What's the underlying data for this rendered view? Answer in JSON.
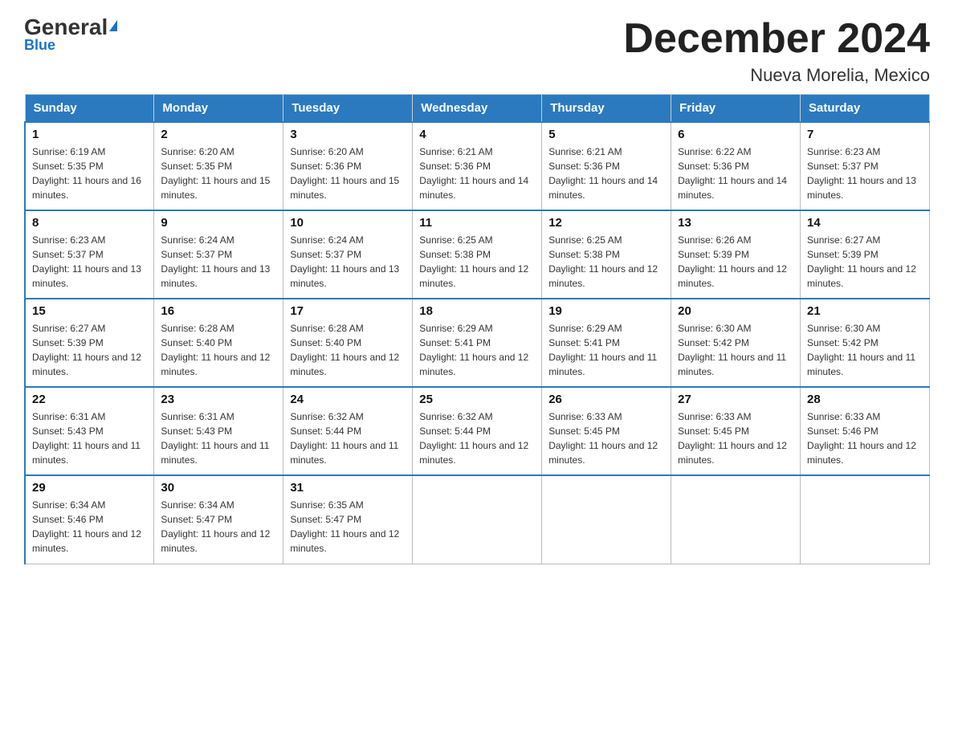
{
  "logo": {
    "main": "General",
    "sub": "Blue",
    "tagline": "Blue"
  },
  "title": "December 2024",
  "subtitle": "Nueva Morelia, Mexico",
  "days_of_week": [
    "Sunday",
    "Monday",
    "Tuesday",
    "Wednesday",
    "Thursday",
    "Friday",
    "Saturday"
  ],
  "weeks": [
    [
      {
        "day": 1,
        "sunrise": "6:19 AM",
        "sunset": "5:35 PM",
        "daylight": "11 hours and 16 minutes."
      },
      {
        "day": 2,
        "sunrise": "6:20 AM",
        "sunset": "5:35 PM",
        "daylight": "11 hours and 15 minutes."
      },
      {
        "day": 3,
        "sunrise": "6:20 AM",
        "sunset": "5:36 PM",
        "daylight": "11 hours and 15 minutes."
      },
      {
        "day": 4,
        "sunrise": "6:21 AM",
        "sunset": "5:36 PM",
        "daylight": "11 hours and 14 minutes."
      },
      {
        "day": 5,
        "sunrise": "6:21 AM",
        "sunset": "5:36 PM",
        "daylight": "11 hours and 14 minutes."
      },
      {
        "day": 6,
        "sunrise": "6:22 AM",
        "sunset": "5:36 PM",
        "daylight": "11 hours and 14 minutes."
      },
      {
        "day": 7,
        "sunrise": "6:23 AM",
        "sunset": "5:37 PM",
        "daylight": "11 hours and 13 minutes."
      }
    ],
    [
      {
        "day": 8,
        "sunrise": "6:23 AM",
        "sunset": "5:37 PM",
        "daylight": "11 hours and 13 minutes."
      },
      {
        "day": 9,
        "sunrise": "6:24 AM",
        "sunset": "5:37 PM",
        "daylight": "11 hours and 13 minutes."
      },
      {
        "day": 10,
        "sunrise": "6:24 AM",
        "sunset": "5:37 PM",
        "daylight": "11 hours and 13 minutes."
      },
      {
        "day": 11,
        "sunrise": "6:25 AM",
        "sunset": "5:38 PM",
        "daylight": "11 hours and 12 minutes."
      },
      {
        "day": 12,
        "sunrise": "6:25 AM",
        "sunset": "5:38 PM",
        "daylight": "11 hours and 12 minutes."
      },
      {
        "day": 13,
        "sunrise": "6:26 AM",
        "sunset": "5:39 PM",
        "daylight": "11 hours and 12 minutes."
      },
      {
        "day": 14,
        "sunrise": "6:27 AM",
        "sunset": "5:39 PM",
        "daylight": "11 hours and 12 minutes."
      }
    ],
    [
      {
        "day": 15,
        "sunrise": "6:27 AM",
        "sunset": "5:39 PM",
        "daylight": "11 hours and 12 minutes."
      },
      {
        "day": 16,
        "sunrise": "6:28 AM",
        "sunset": "5:40 PM",
        "daylight": "11 hours and 12 minutes."
      },
      {
        "day": 17,
        "sunrise": "6:28 AM",
        "sunset": "5:40 PM",
        "daylight": "11 hours and 12 minutes."
      },
      {
        "day": 18,
        "sunrise": "6:29 AM",
        "sunset": "5:41 PM",
        "daylight": "11 hours and 12 minutes."
      },
      {
        "day": 19,
        "sunrise": "6:29 AM",
        "sunset": "5:41 PM",
        "daylight": "11 hours and 11 minutes."
      },
      {
        "day": 20,
        "sunrise": "6:30 AM",
        "sunset": "5:42 PM",
        "daylight": "11 hours and 11 minutes."
      },
      {
        "day": 21,
        "sunrise": "6:30 AM",
        "sunset": "5:42 PM",
        "daylight": "11 hours and 11 minutes."
      }
    ],
    [
      {
        "day": 22,
        "sunrise": "6:31 AM",
        "sunset": "5:43 PM",
        "daylight": "11 hours and 11 minutes."
      },
      {
        "day": 23,
        "sunrise": "6:31 AM",
        "sunset": "5:43 PM",
        "daylight": "11 hours and 11 minutes."
      },
      {
        "day": 24,
        "sunrise": "6:32 AM",
        "sunset": "5:44 PM",
        "daylight": "11 hours and 11 minutes."
      },
      {
        "day": 25,
        "sunrise": "6:32 AM",
        "sunset": "5:44 PM",
        "daylight": "11 hours and 12 minutes."
      },
      {
        "day": 26,
        "sunrise": "6:33 AM",
        "sunset": "5:45 PM",
        "daylight": "11 hours and 12 minutes."
      },
      {
        "day": 27,
        "sunrise": "6:33 AM",
        "sunset": "5:45 PM",
        "daylight": "11 hours and 12 minutes."
      },
      {
        "day": 28,
        "sunrise": "6:33 AM",
        "sunset": "5:46 PM",
        "daylight": "11 hours and 12 minutes."
      }
    ],
    [
      {
        "day": 29,
        "sunrise": "6:34 AM",
        "sunset": "5:46 PM",
        "daylight": "11 hours and 12 minutes."
      },
      {
        "day": 30,
        "sunrise": "6:34 AM",
        "sunset": "5:47 PM",
        "daylight": "11 hours and 12 minutes."
      },
      {
        "day": 31,
        "sunrise": "6:35 AM",
        "sunset": "5:47 PM",
        "daylight": "11 hours and 12 minutes."
      },
      null,
      null,
      null,
      null
    ]
  ]
}
